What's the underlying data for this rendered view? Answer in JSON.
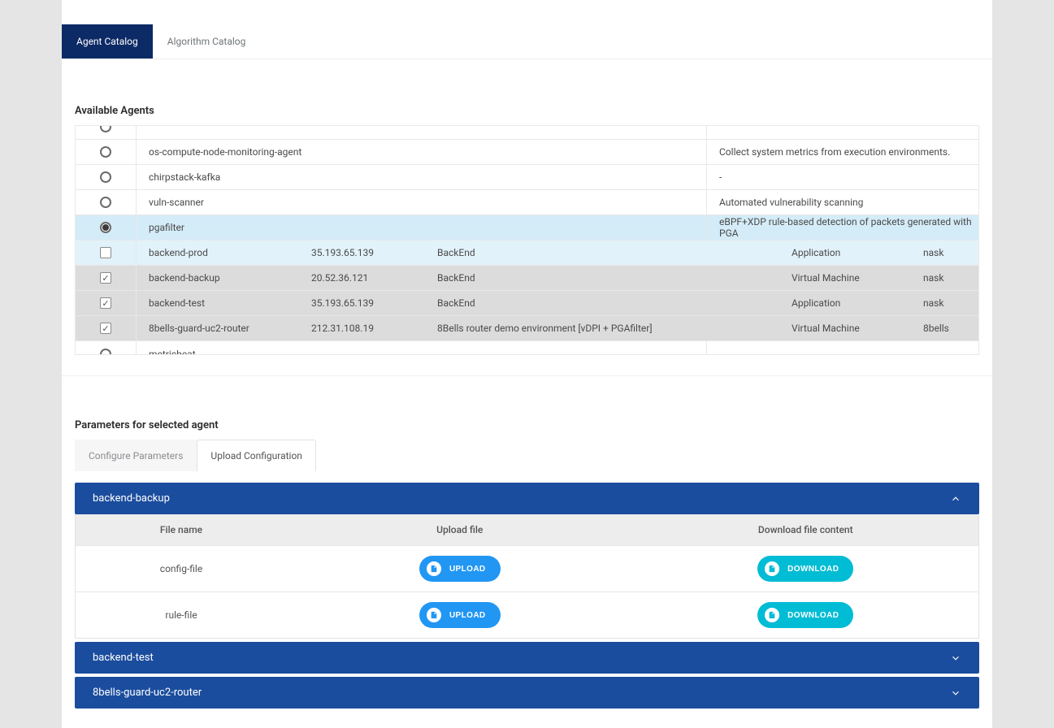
{
  "topTabs": {
    "agentCatalog": "Agent Catalog",
    "algorithmCatalog": "Algorithm Catalog",
    "activeIndex": 0
  },
  "availableAgentsTitle": "Available Agents",
  "agents": [
    {
      "kind": "agent",
      "selectType": "radio",
      "selected": false,
      "name": "",
      "desc": ""
    },
    {
      "kind": "agent",
      "selectType": "radio",
      "selected": false,
      "name": "os-compute-node-monitoring-agent",
      "desc": "Collect system metrics from execution environments."
    },
    {
      "kind": "agent",
      "selectType": "radio",
      "selected": false,
      "name": "chirpstack-kafka",
      "desc": "-"
    },
    {
      "kind": "agent",
      "selectType": "radio",
      "selected": false,
      "name": "vuln-scanner",
      "desc": "Automated vulnerability scanning"
    },
    {
      "kind": "agent",
      "selectType": "radio",
      "selected": true,
      "name": "pgafilter",
      "desc": "eBPF+XDP rule-based detection of packets generated with PGA"
    },
    {
      "kind": "instance",
      "selectType": "check",
      "checked": false,
      "name": "backend-prod",
      "ip": "35.193.65.139",
      "col3": "BackEnd",
      "type": "Application",
      "org": "nask",
      "shade": "light"
    },
    {
      "kind": "instance",
      "selectType": "check",
      "checked": true,
      "name": "backend-backup",
      "ip": "20.52.36.121",
      "col3": "BackEnd",
      "type": "Virtual Machine",
      "org": "nask",
      "shade": "dark"
    },
    {
      "kind": "instance",
      "selectType": "check",
      "checked": true,
      "name": "backend-test",
      "ip": "35.193.65.139",
      "col3": "BackEnd",
      "type": "Application",
      "org": "nask",
      "shade": "dark"
    },
    {
      "kind": "instance",
      "selectType": "check",
      "checked": true,
      "name": "8bells-guard-uc2-router",
      "ip": "212.31.108.19",
      "col3": "8Bells router demo environment [vDPI + PGAfilter]",
      "type": "Virtual Machine",
      "org": "8bells",
      "shade": "dark"
    },
    {
      "kind": "agent",
      "selectType": "radio",
      "selected": false,
      "name": "metricbeat",
      "desc": "-"
    }
  ],
  "paramsTitle": "Parameters for selected agent",
  "paramTabs": {
    "configure": "Configure Parameters",
    "upload": "Upload Configuration",
    "activeIndex": 1
  },
  "fileTableHeaders": {
    "fileName": "File name",
    "uploadFile": "Upload file",
    "downloadFile": "Download file content"
  },
  "buttons": {
    "upload": "UPLOAD",
    "download": "DOWNLOAD"
  },
  "accordion": [
    {
      "title": "backend-backup",
      "expanded": true,
      "files": [
        {
          "name": "config-file"
        },
        {
          "name": "rule-file"
        }
      ]
    },
    {
      "title": "backend-test",
      "expanded": false
    },
    {
      "title": "8bells-guard-uc2-router",
      "expanded": false
    }
  ],
  "colors": {
    "primaryDark": "#0c2a66",
    "accordionBlue": "#1b4d9e",
    "uploadBlue": "#2196f3",
    "downloadTeal": "#00bcd4",
    "rowSelected": "#d4ecf8",
    "rowChildLight": "#e2f2fb",
    "rowChildDark": "#dcdcdc"
  }
}
